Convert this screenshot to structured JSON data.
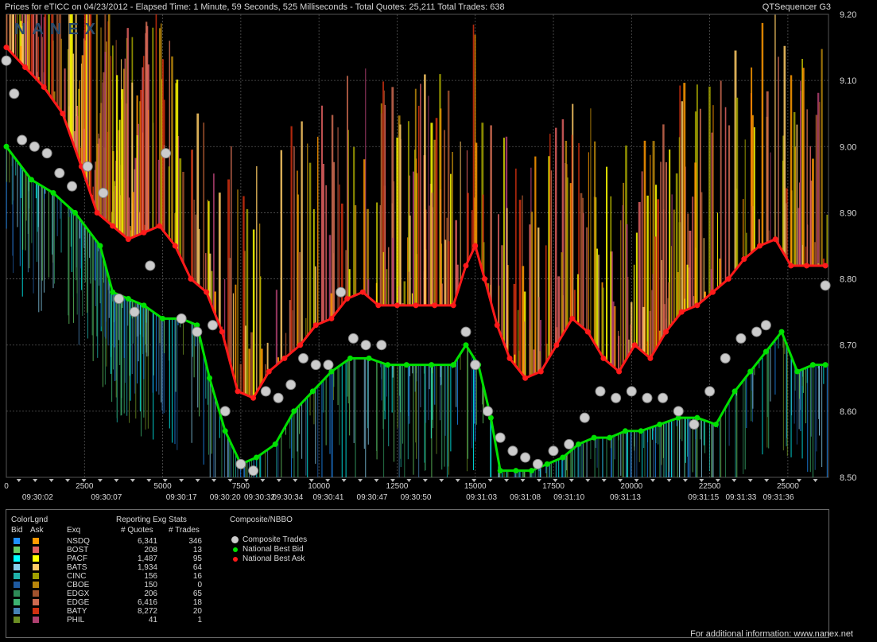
{
  "header": {
    "title": "Prices for  eTICC  on  04/23/2012  -  Elapsed Time: 1 Minute, 59 Seconds, 525 Milliseconds  -  Total Quotes: 25,211  Total Trades: 638",
    "brand": "QTSequencer G3",
    "watermark": "NANEX"
  },
  "chart_data": {
    "type": "line",
    "title": "",
    "xlabel": "",
    "ylabel": "",
    "ylim": [
      8.5,
      9.2
    ],
    "xlim": [
      0,
      26300
    ],
    "y_ticks": [
      "9.20",
      "9.10",
      "9.00",
      "8.90",
      "8.80",
      "8.70",
      "8.60",
      "8.50"
    ],
    "y_tick_values": [
      9.2,
      9.1,
      9.0,
      8.9,
      8.8,
      8.7,
      8.6,
      8.5
    ],
    "x_ticks": [
      "0",
      "2500",
      "5000",
      "7500",
      "10000",
      "12500",
      "15000",
      "17500",
      "20000",
      "22500",
      "25000"
    ],
    "x_tick_values": [
      0,
      2500,
      5000,
      7500,
      10000,
      12500,
      15000,
      17500,
      20000,
      22500,
      25000
    ],
    "time_labels": [
      {
        "x": 1000,
        "t": "09:30:02"
      },
      {
        "x": 3200,
        "t": "09:30:07"
      },
      {
        "x": 5600,
        "t": "09:30:17"
      },
      {
        "x": 7000,
        "t": "09:30:20"
      },
      {
        "x": 8100,
        "t": "09:30:32"
      },
      {
        "x": 9000,
        "t": "09:30:34"
      },
      {
        "x": 10300,
        "t": "09:30:41"
      },
      {
        "x": 11700,
        "t": "09:30:47"
      },
      {
        "x": 13100,
        "t": "09:30:50"
      },
      {
        "x": 15200,
        "t": "09:31:03"
      },
      {
        "x": 16600,
        "t": "09:31:08"
      },
      {
        "x": 18000,
        "t": "09:31:10"
      },
      {
        "x": 19800,
        "t": "09:31:13"
      },
      {
        "x": 22300,
        "t": "09:31:15"
      },
      {
        "x": 23500,
        "t": "09:31:33"
      },
      {
        "x": 24700,
        "t": "09:31:36"
      }
    ],
    "grid": true,
    "series": [
      {
        "name": "National Best Bid",
        "color": "#00e000",
        "x": [
          0,
          800,
          1500,
          2200,
          3000,
          3400,
          3900,
          4400,
          5000,
          5600,
          6100,
          6500,
          7000,
          7500,
          8000,
          8600,
          9200,
          9800,
          10400,
          11000,
          11600,
          12200,
          12800,
          13600,
          14300,
          14700,
          15100,
          15500,
          15800,
          16300,
          16800,
          17300,
          17800,
          18300,
          18800,
          19300,
          19800,
          20300,
          20900,
          21500,
          22100,
          22700,
          23300,
          23800,
          24300,
          24800,
          25300,
          25800,
          26200
        ],
        "y": [
          9.0,
          8.95,
          8.93,
          8.9,
          8.85,
          8.78,
          8.77,
          8.76,
          8.74,
          8.74,
          8.73,
          8.65,
          8.57,
          8.52,
          8.53,
          8.55,
          8.6,
          8.63,
          8.66,
          8.68,
          8.68,
          8.67,
          8.67,
          8.67,
          8.67,
          8.7,
          8.67,
          8.59,
          8.51,
          8.51,
          8.51,
          8.52,
          8.53,
          8.55,
          8.56,
          8.56,
          8.57,
          8.57,
          8.58,
          8.59,
          8.59,
          8.58,
          8.63,
          8.66,
          8.69,
          8.72,
          8.66,
          8.67,
          8.67
        ]
      },
      {
        "name": "National Best Ask",
        "color": "#ff1a1a",
        "x": [
          0,
          600,
          1200,
          1800,
          2400,
          2900,
          3400,
          3900,
          4400,
          4900,
          5400,
          5900,
          6400,
          6900,
          7400,
          7900,
          8400,
          8900,
          9400,
          9900,
          10400,
          10900,
          11400,
          11900,
          12500,
          13100,
          13700,
          14300,
          14700,
          15000,
          15300,
          15700,
          16100,
          16600,
          17100,
          17600,
          18100,
          18600,
          19100,
          19600,
          20100,
          20600,
          21100,
          21600,
          22100,
          22600,
          23100,
          23600,
          24100,
          24600,
          25100,
          25600,
          26200
        ],
        "y": [
          9.15,
          9.12,
          9.09,
          9.05,
          8.97,
          8.9,
          8.88,
          8.86,
          8.87,
          8.88,
          8.85,
          8.8,
          8.78,
          8.72,
          8.63,
          8.62,
          8.66,
          8.68,
          8.7,
          8.73,
          8.74,
          8.77,
          8.78,
          8.76,
          8.76,
          8.76,
          8.76,
          8.76,
          8.82,
          8.85,
          8.8,
          8.73,
          8.68,
          8.65,
          8.66,
          8.7,
          8.74,
          8.72,
          8.68,
          8.66,
          8.7,
          8.68,
          8.72,
          8.75,
          8.76,
          8.78,
          8.8,
          8.83,
          8.85,
          8.86,
          8.82,
          8.82,
          8.82
        ]
      },
      {
        "name": "Composite Trades",
        "color": "#cccccc",
        "x": [
          0,
          250,
          500,
          900,
          1300,
          1700,
          2100,
          2600,
          3100,
          3600,
          4100,
          4600,
          5100,
          5600,
          6100,
          6600,
          7000,
          7500,
          7900,
          8300,
          8700,
          9100,
          9500,
          9900,
          10300,
          10700,
          11100,
          11500,
          12000,
          14700,
          15000,
          15400,
          15800,
          16200,
          16600,
          17000,
          17500,
          18000,
          18500,
          19000,
          19500,
          20000,
          20500,
          21000,
          21500,
          22000,
          22500,
          23000,
          23500,
          24000,
          24300,
          26200
        ],
        "y": [
          9.13,
          9.08,
          9.01,
          9.0,
          8.99,
          8.96,
          8.94,
          8.97,
          8.93,
          8.77,
          8.75,
          8.82,
          8.99,
          8.74,
          8.72,
          8.73,
          8.6,
          8.52,
          8.51,
          8.63,
          8.62,
          8.64,
          8.68,
          8.67,
          8.67,
          8.78,
          8.71,
          8.7,
          8.7,
          8.72,
          8.67,
          8.6,
          8.56,
          8.54,
          8.53,
          8.52,
          8.54,
          8.55,
          8.59,
          8.63,
          8.62,
          8.63,
          8.62,
          8.62,
          8.6,
          8.58,
          8.63,
          8.68,
          8.71,
          8.72,
          8.73,
          8.79
        ]
      }
    ],
    "exchange_colors": {
      "NSDQ": [
        "#1e90ff",
        "#ff9900"
      ],
      "BOST": [
        "#66cc66",
        "#e06060"
      ],
      "PACF": [
        "#00ffff",
        "#ffff00"
      ],
      "BATS": [
        "#87ceeb",
        "#ffcc66"
      ],
      "CINC": [
        "#20b2aa",
        "#a0a000"
      ],
      "CBOE": [
        "#1e5aa0",
        "#b8860b"
      ],
      "EDGX": [
        "#2e8b57",
        "#a0522d"
      ],
      "EDGE": [
        "#3cb371",
        "#cd6a50"
      ],
      "BATY": [
        "#4682b4",
        "#d03010"
      ],
      "PHIL": [
        "#6b8e23",
        "#b04070"
      ]
    }
  },
  "legend": {
    "colorlgnd": "ColorLgnd",
    "bid": "Bid",
    "ask": "Ask",
    "exq": "Exq",
    "reporting": "Reporting Exg Stats",
    "quotes_h": "# Quotes",
    "trades_h": "# Trades",
    "composite_h": "Composite/NBBO",
    "rows": [
      {
        "exq": "NSDQ",
        "quotes": "6,341",
        "trades": "346",
        "bid_color": "#1e90ff",
        "ask_color": "#ff9900"
      },
      {
        "exq": "BOST",
        "quotes": "208",
        "trades": "13",
        "bid_color": "#66cc66",
        "ask_color": "#e06060"
      },
      {
        "exq": "PACF",
        "quotes": "1,487",
        "trades": "95",
        "bid_color": "#00ffff",
        "ask_color": "#ffff00"
      },
      {
        "exq": "BATS",
        "quotes": "1,934",
        "trades": "64",
        "bid_color": "#87ceeb",
        "ask_color": "#ffcc66"
      },
      {
        "exq": "CINC",
        "quotes": "156",
        "trades": "16",
        "bid_color": "#20b2aa",
        "ask_color": "#a0a000"
      },
      {
        "exq": "CBOE",
        "quotes": "150",
        "trades": "0",
        "bid_color": "#1e5aa0",
        "ask_color": "#b8860b"
      },
      {
        "exq": "EDGX",
        "quotes": "206",
        "trades": "65",
        "bid_color": "#2e8b57",
        "ask_color": "#a0522d"
      },
      {
        "exq": "EDGE",
        "quotes": "6,416",
        "trades": "18",
        "bid_color": "#3cb371",
        "ask_color": "#cd6a50"
      },
      {
        "exq": "BATY",
        "quotes": "8,272",
        "trades": "20",
        "bid_color": "#4682b4",
        "ask_color": "#d03010"
      },
      {
        "exq": "PHIL",
        "quotes": "41",
        "trades": "1",
        "bid_color": "#6b8e23",
        "ask_color": "#b04070"
      }
    ],
    "composite_items": [
      {
        "label": "Composite Trades",
        "color": "#cccccc"
      },
      {
        "label": "National Best Bid",
        "color": "#00e000"
      },
      {
        "label": "National Best Ask",
        "color": "#ff1a1a"
      }
    ],
    "footer": "For additional information: www.nanex.net"
  }
}
